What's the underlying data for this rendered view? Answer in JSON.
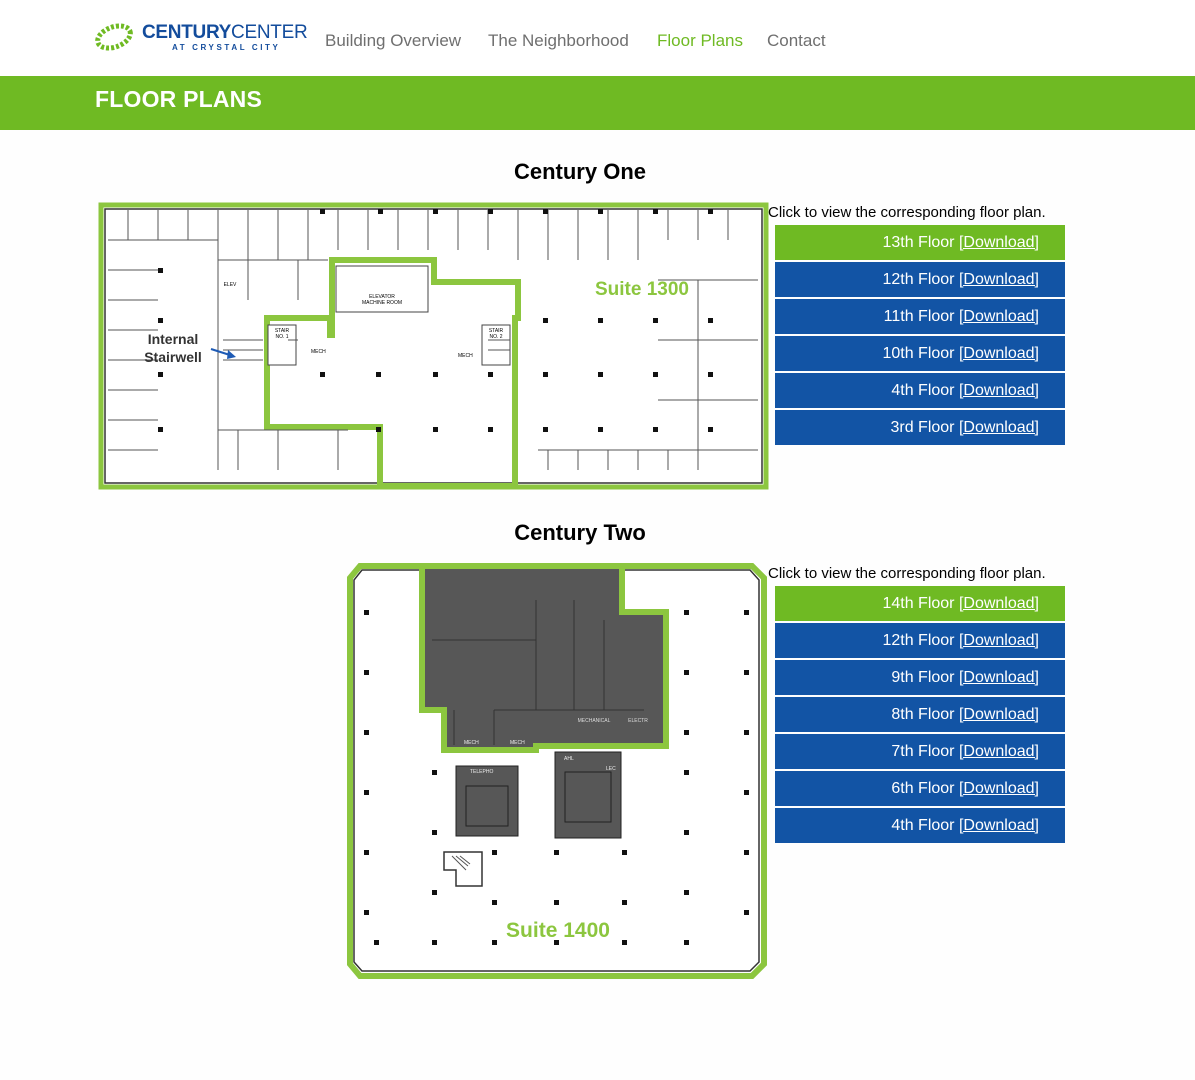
{
  "brand": {
    "name_bold": "CENTURY",
    "name_rest": "CENTER",
    "subtitle": "AT CRYSTAL CITY",
    "green": "#6fba23",
    "blue": "#134c9c"
  },
  "nav": [
    {
      "label": "Building Overview",
      "active": false
    },
    {
      "label": "The Neighborhood",
      "active": false
    },
    {
      "label": "Floor Plans",
      "active": true
    },
    {
      "label": "Contact",
      "active": false
    }
  ],
  "page_title": "FLOOR PLANS",
  "buildings": [
    {
      "title": "Century One",
      "hint": "Click to view the corresponding floor plan.",
      "plan": {
        "suite_label": "Suite 1300",
        "callout": [
          "Internal",
          "Stairwell"
        ],
        "room_labels": [
          "ELEVATOR",
          "MACHINE ROOM",
          "ELEV",
          "MECH",
          "MECH",
          "STAIR",
          "NO. 1",
          "STAIR",
          "NO. 2"
        ]
      },
      "floors": [
        {
          "label": "13th Floor",
          "link": "[Download]",
          "selected": true
        },
        {
          "label": "12th Floor",
          "link": "[Download]",
          "selected": false
        },
        {
          "label": "11th Floor",
          "link": "[Download]",
          "selected": false
        },
        {
          "label": "10th Floor",
          "link": "[Download]",
          "selected": false
        },
        {
          "label": "4th Floor",
          "link": "[Download]",
          "selected": false
        },
        {
          "label": "3rd Floor",
          "link": "[Download]",
          "selected": false
        }
      ]
    },
    {
      "title": "Century Two",
      "hint": "Click to view the corresponding floor plan.",
      "plan": {
        "suite_label": "Suite 1400",
        "room_labels": [
          "MECHANICAL",
          "ELECTR",
          "TELEPHO",
          "MECH",
          "MECH",
          "AHL",
          "LEC"
        ]
      },
      "floors": [
        {
          "label": "14th Floor",
          "link": "[Download]",
          "selected": true
        },
        {
          "label": "12th Floor",
          "link": "[Download]",
          "selected": false
        },
        {
          "label": "9th Floor",
          "link": "[Download]",
          "selected": false
        },
        {
          "label": "8th Floor",
          "link": "[Download]",
          "selected": false
        },
        {
          "label": "7th Floor",
          "link": "[Download]",
          "selected": false
        },
        {
          "label": "6th Floor",
          "link": "[Download]",
          "selected": false
        },
        {
          "label": "4th Floor",
          "link": "[Download]",
          "selected": false
        }
      ]
    }
  ]
}
